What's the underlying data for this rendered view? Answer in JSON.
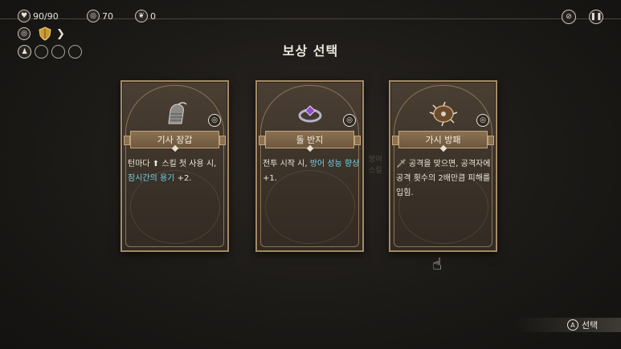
{
  "hud": {
    "health": "90/90",
    "coins": "70",
    "leaves": "0"
  },
  "title": "보상 선택",
  "cards": [
    {
      "name": "기사 장갑",
      "desc_parts": [
        "턴마다 ",
        "⬆",
        " 스킬 첫 사용 시, ",
        "잠시간의 용기",
        " +2."
      ]
    },
    {
      "name": "돌 반지",
      "desc_parts": [
        "전투 시작 시, ",
        "방어 성능 향상",
        " +1."
      ]
    },
    {
      "name": "가시 방패",
      "desc_parts": [
        "🗡",
        " 공격을 맞으면, 공격자에 공격 횟수의 2배만큼 피해를 입힘."
      ]
    }
  ],
  "ghost_text": [
    "방어",
    "스킬"
  ],
  "footer": {
    "button_glyph": "A",
    "select_label": "선택"
  },
  "colors": {
    "highlight": "#6fd3e8",
    "card_border": "#a58b66"
  }
}
